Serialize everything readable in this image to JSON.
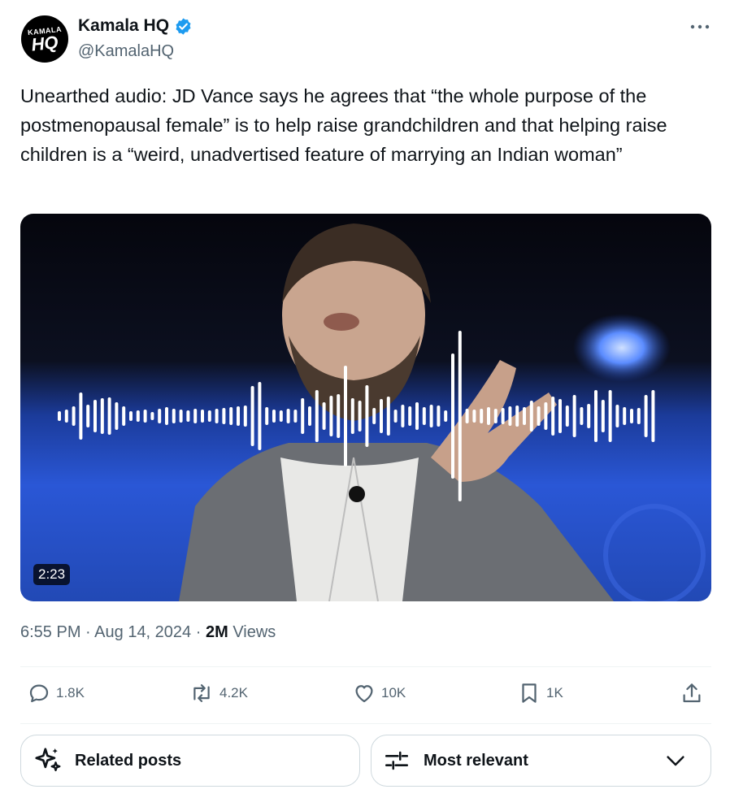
{
  "author": {
    "display_name": "Kamala HQ",
    "handle": "@KamalaHQ",
    "avatar_text_top": "KAMALA",
    "avatar_text_main": "HQ",
    "verified": true
  },
  "tweet": {
    "text": "Unearthed audio: JD Vance says he agrees that “the whole purpose of the postmenopausal female” is to help raise grandchildren and that helping raise children is a “weird, unadvertised feature of marrying an Indian woman”"
  },
  "media": {
    "type": "video",
    "duration": "2:23"
  },
  "meta": {
    "time": "6:55 PM",
    "date": "Aug 14, 2024",
    "views_count": "2M",
    "views_label": "Views"
  },
  "actions": {
    "replies": "1.8K",
    "reposts": "4.2K",
    "likes": "10K",
    "bookmarks": "1K"
  },
  "footer": {
    "related_label": "Related posts",
    "sort_label": "Most relevant"
  },
  "colors": {
    "text": "#0f1419",
    "secondary": "#536471",
    "verified_blue": "#1d9bf0",
    "border": "#cfd9de"
  }
}
